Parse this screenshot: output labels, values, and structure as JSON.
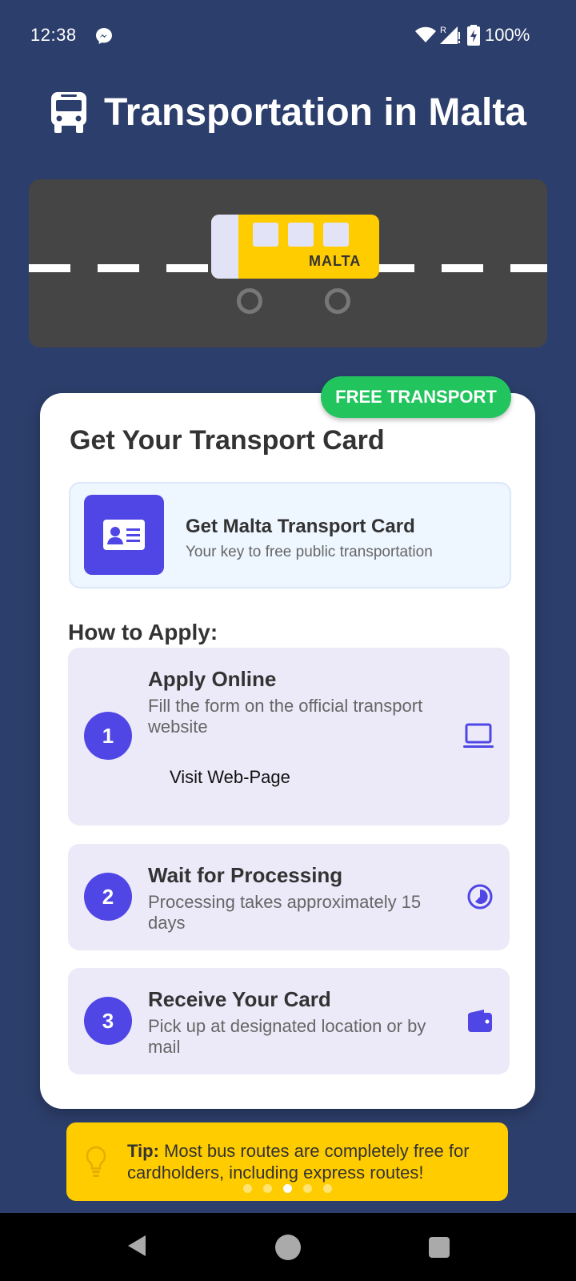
{
  "status_bar": {
    "time": "12:38",
    "battery": "100%",
    "icons": [
      "messenger-icon",
      "wifi-icon",
      "signal-icon",
      "battery-icon"
    ]
  },
  "header": {
    "title": "Transportation in Malta",
    "icon": "bus-icon"
  },
  "illustration": {
    "bus_label": "MALTA"
  },
  "card": {
    "badge": "FREE TRANSPORT",
    "title": "Get Your Transport Card",
    "transport_card": {
      "title": "Get Malta Transport Card",
      "subtitle": "Your key to free public transportation",
      "icon": "id-card-icon"
    },
    "how_to_apply_label": "How to Apply:",
    "steps": [
      {
        "number": "1",
        "title": "Apply Online",
        "description": "Fill the form on the official transport website",
        "link": "Visit Web-Page",
        "icon": "laptop-icon"
      },
      {
        "number": "2",
        "title": "Wait for Processing",
        "description": "Processing takes approximately 15 days",
        "icon": "clock-icon"
      },
      {
        "number": "3",
        "title": "Receive Your Card",
        "description": "Pick up at designated location or by mail",
        "icon": "wallet-icon"
      }
    ]
  },
  "tip": {
    "label": "Tip:",
    "text": "Most bus routes are completely free for cardholders, including express routes!",
    "icon": "lightbulb-icon"
  },
  "pagination": {
    "total": 5,
    "active_index": 2
  },
  "colors": {
    "background": "#2c3e6b",
    "accent": "#4f46e5",
    "badge": "#22c45e",
    "bus_yellow": "#ffcc00"
  }
}
